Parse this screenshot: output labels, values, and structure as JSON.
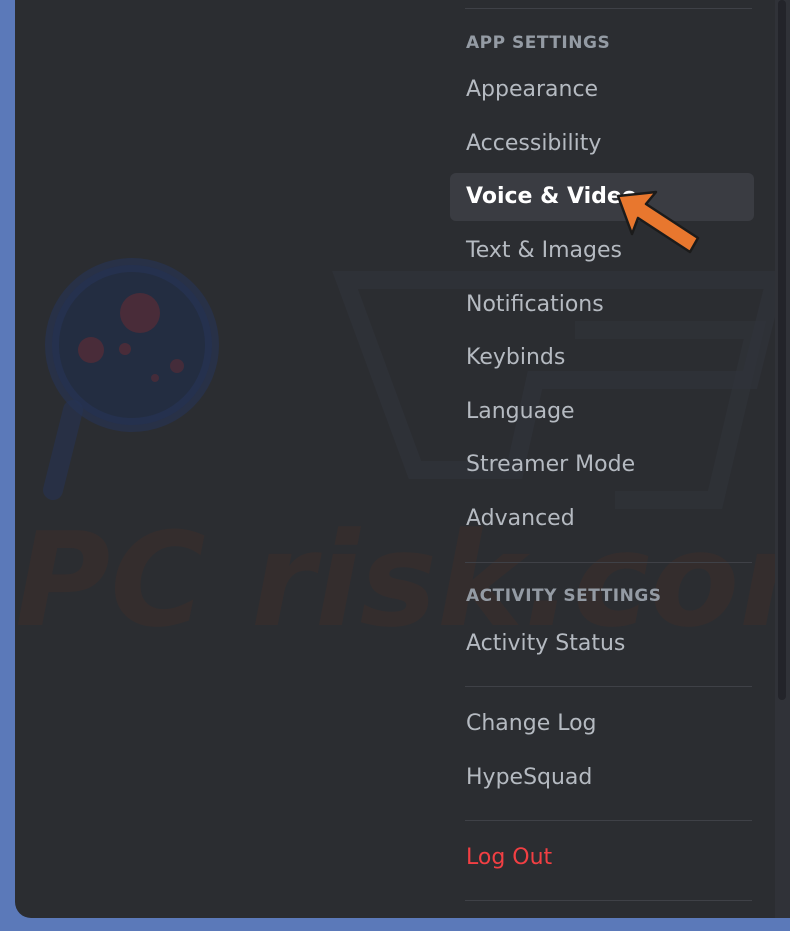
{
  "settings_nav": {
    "sections": [
      {
        "header": "APP SETTINGS",
        "items": [
          {
            "label": "Appearance"
          },
          {
            "label": "Accessibility"
          },
          {
            "label": "Voice & Video"
          },
          {
            "label": "Text & Images"
          },
          {
            "label": "Notifications"
          },
          {
            "label": "Keybinds"
          },
          {
            "label": "Language"
          },
          {
            "label": "Streamer Mode"
          },
          {
            "label": "Advanced"
          }
        ]
      },
      {
        "header": "ACTIVITY SETTINGS",
        "items": [
          {
            "label": "Activity Status"
          }
        ]
      },
      {
        "header": "",
        "items": [
          {
            "label": "Change Log"
          },
          {
            "label": "HypeSquad"
          }
        ]
      },
      {
        "header": "",
        "items": [
          {
            "label": "Log Out"
          }
        ]
      }
    ],
    "selected_item": "Voice & Video"
  },
  "watermark": {
    "text": "PC risk.com"
  },
  "colors": {
    "background_blue": "#5b79b9",
    "sidebar": "#2b2d31",
    "selected_item_bg": "#3a3c42",
    "header_text": "#949ba4",
    "item_text": "#b5bac1",
    "selected_text": "#ffffff",
    "logout_red": "#f23f43",
    "annotation_arrow": "#e8772e"
  }
}
